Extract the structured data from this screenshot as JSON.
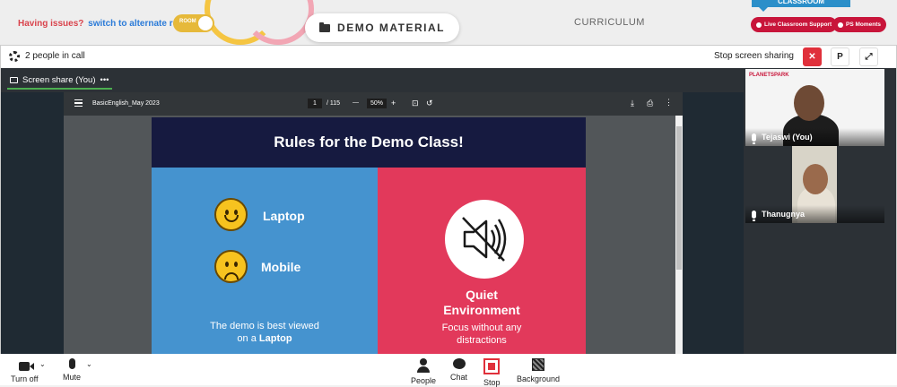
{
  "topbar": {
    "issue_text": "Having issues?",
    "issue_link": "switch to alternate room",
    "room_toggle_label": "ROOM",
    "demo_tab_label": "DEMO MATERIAL",
    "curriculum_label": "CURRICULUM",
    "classroom_tab": "CLASSROOM",
    "support_button": "Live Classroom Support",
    "moments_button": "PS Moments"
  },
  "meeting": {
    "people_in_call": "2 people in call",
    "stop_sharing_label": "Stop screen sharing",
    "pin_button": "P",
    "share_tab_label": "Screen share (You)",
    "share_tab_more": "•••"
  },
  "pdf": {
    "filename": "BasicEnglish_May 2023",
    "page_current": "1",
    "page_total": "/ 115",
    "zoom": "50%",
    "zoom_out": "—",
    "zoom_in": "+"
  },
  "slide": {
    "title": "Rules for the Demo Class!",
    "laptop_label": "Laptop",
    "mobile_label": "Mobile",
    "left_caption_line1": "The demo is best viewed",
    "left_caption_line2_prefix": "on a",
    "left_caption_line2_bold": "Laptop",
    "right_title_line1": "Quiet",
    "right_title_line2": "Environment",
    "right_caption_line1": "Focus without any",
    "right_caption_line2": "distractions"
  },
  "participants": [
    {
      "name": "Tejaswi (You)",
      "logo_text": "PLANETSPARK"
    },
    {
      "name": "Thanugnya"
    }
  ],
  "controls": {
    "turn_off": "Turn off",
    "mute": "Mute",
    "people": "People",
    "chat": "Chat",
    "stop": "Stop",
    "background": "Background"
  },
  "colors": {
    "accent_red": "#c8153a",
    "slide_navy": "#161a40",
    "slide_blue": "#4593cf",
    "slide_pink": "#e2395b"
  }
}
